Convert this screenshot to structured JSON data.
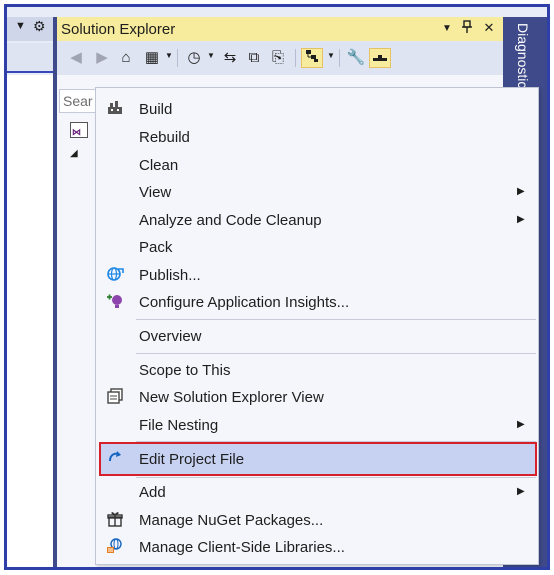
{
  "left_pane": {
    "dropdown_icon": "triangle-down",
    "settings_icon": "gear"
  },
  "solution_explorer": {
    "title": "Solution Explorer",
    "title_buttons": [
      "window-position-dropdown",
      "pin",
      "close"
    ],
    "toolbar": [
      "back",
      "forward",
      "home",
      "switch-views",
      "pending-changes-filter",
      "sync-with-active-document",
      "collapse-all",
      "show-all-files",
      "preview-selected",
      "properties",
      "toggle-preview"
    ],
    "search_placeholder": "Sear",
    "tree": [
      "solution-node",
      "project-node"
    ]
  },
  "diagnostics_tab": {
    "label": "Diagnostic"
  },
  "context_menu": {
    "items": [
      {
        "label": "Build",
        "icon": "build-icon",
        "submenu": false
      },
      {
        "label": "Rebuild",
        "icon": "",
        "submenu": false
      },
      {
        "label": "Clean",
        "icon": "",
        "submenu": false
      },
      {
        "label": "View",
        "icon": "",
        "submenu": true
      },
      {
        "label": "Analyze and Code Cleanup",
        "icon": "",
        "submenu": true
      },
      {
        "label": "Pack",
        "icon": "",
        "submenu": false
      },
      {
        "label": "Publish...",
        "icon": "publish-globe-icon",
        "submenu": false
      },
      {
        "label": "Configure Application Insights...",
        "icon": "app-insights-icon",
        "submenu": false
      },
      {
        "label": "Overview",
        "icon": "",
        "submenu": false
      },
      {
        "label": "Scope to This",
        "icon": "",
        "submenu": false
      },
      {
        "label": "New Solution Explorer View",
        "icon": "new-explorer-view-icon",
        "submenu": false
      },
      {
        "label": "File Nesting",
        "icon": "",
        "submenu": true
      },
      {
        "label": "Edit Project File",
        "icon": "edit-file-arrow-icon",
        "submenu": false
      },
      {
        "label": "Add",
        "icon": "",
        "submenu": true
      },
      {
        "label": "Manage NuGet Packages...",
        "icon": "nuget-package-icon",
        "submenu": false
      },
      {
        "label": "Manage Client-Side Libraries...",
        "icon": "client-libraries-icon",
        "submenu": false
      }
    ],
    "highlighted_item": "Edit Project File"
  },
  "colors": {
    "accent_frame": "#2e3fa8",
    "title_active": "#f7ec9d",
    "highlight": "#c7d2f2",
    "highlight_border": "#d6202c",
    "diagnostics_bg": "#3f4a8a"
  }
}
